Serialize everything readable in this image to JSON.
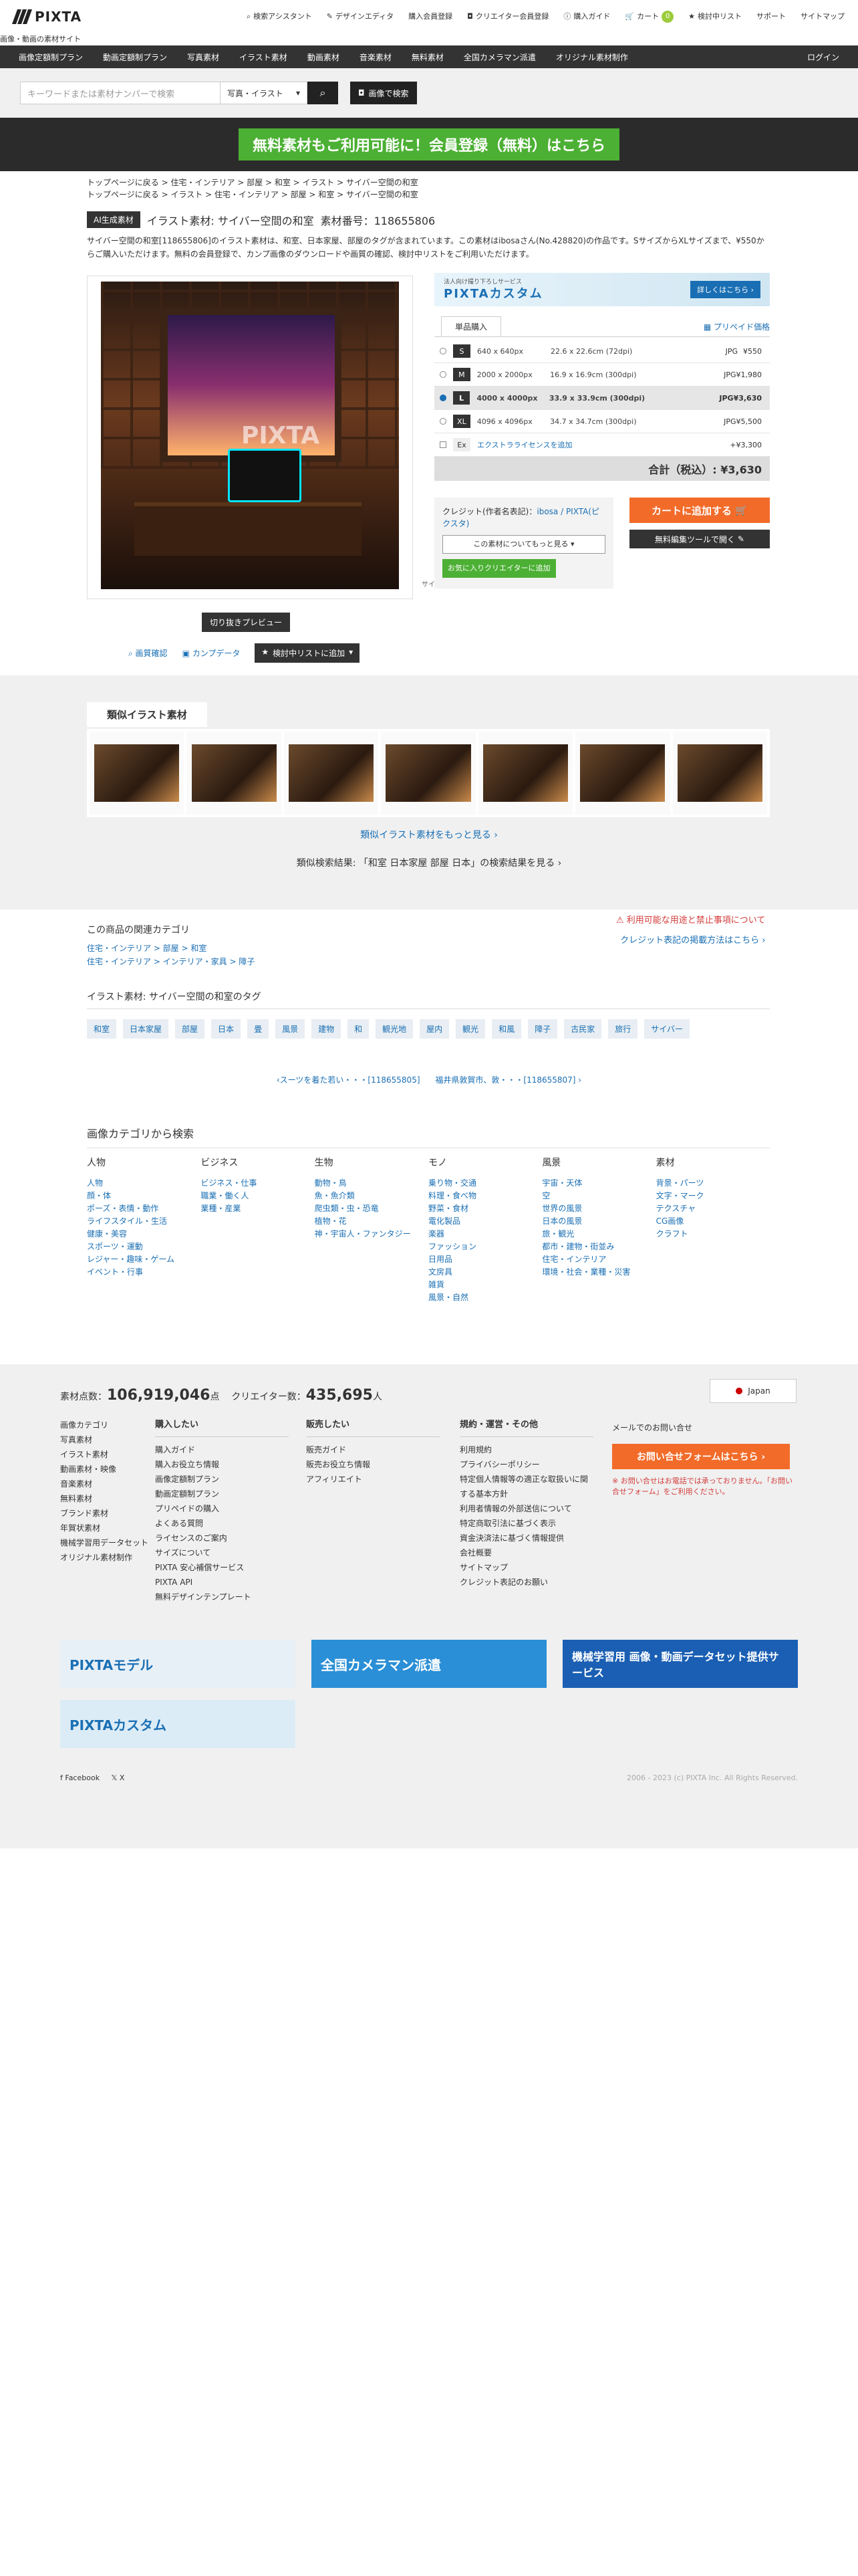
{
  "brand": {
    "name": "PIXTA",
    "tagline": "画像・動画の素材サイト"
  },
  "topnav": [
    {
      "icon": "search-icon",
      "label": "検索アシスタント"
    },
    {
      "icon": "edit-icon",
      "label": "デザインエディタ"
    },
    {
      "icon": "",
      "label": "購入会員登録"
    },
    {
      "icon": "camera-icon",
      "label": "クリエイター会員登録"
    },
    {
      "icon": "info-icon",
      "label": "購入ガイド"
    },
    {
      "icon": "cart-icon",
      "label": "カート",
      "badge": "0"
    },
    {
      "icon": "star-icon",
      "label": "検討中リスト"
    },
    {
      "icon": "",
      "label": "サポート"
    },
    {
      "icon": "",
      "label": "サイトマップ"
    }
  ],
  "mainnav": [
    "画像定額制プラン",
    "動画定額制プラン",
    "写真素材",
    "イラスト素材",
    "動画素材",
    "音楽素材",
    "無料素材",
    "全国カメラマン派遣",
    "オリジナル素材制作"
  ],
  "login": "ログイン",
  "search": {
    "placeholder": "キーワードまたは素材ナンバーで検索",
    "category": "写真・イラスト",
    "image_search": "画像で検索"
  },
  "banner": "無料素材もご利用可能に！会員登録（無料）はこちら",
  "breadcrumbs": [
    "トップページに戻る > 住宅・インテリア > 部屋 > 和室 > イラスト > サイバー空間の和室",
    "トップページに戻る > イラスト > 住宅・インテリア > 部屋 > 和室 > サイバー空間の和室"
  ],
  "item": {
    "ai_tag": "AI生成素材",
    "title": "イラスト素材: サイバー空間の和室",
    "number": "素材番号：118655806",
    "description": "サイバー空間の和室[118655806]のイラスト素材は、和室、日本家屋、部屋のタグが含まれています。この素材はibosaさん(No.428820)の作品です。SサイズからXLサイズまで、¥550からご購入いただけます。無料の会員登録で、カンプ画像のダウンロードや画質の確認、検討中リストをご利用いただけます。",
    "caption": "サイバー空間の和室",
    "watermark": "PIXTA"
  },
  "preview": {
    "crop": "切り抜きプレビュー",
    "quality": "画質確認",
    "comp": "カンプデータ",
    "fav": "検討中リストに追加"
  },
  "promo": {
    "title": "PIXTAカスタム",
    "sub": "法人向け撮り下ろしサービス",
    "cta": "詳しくはこちら ›"
  },
  "purchase": {
    "tab": "単品購入",
    "license": "プリペイド価格",
    "rows": [
      {
        "size": "S",
        "px": "640 x 640px",
        "phys": "22.6 x 22.6cm (72dpi)",
        "fmt": "JPG",
        "price": "¥550"
      },
      {
        "size": "M",
        "px": "2000 x 2000px",
        "phys": "16.9 x 16.9cm (300dpi)",
        "fmt": "JPG",
        "price": "¥1,980"
      },
      {
        "size": "L",
        "px": "4000 x 4000px",
        "phys": "33.9 x 33.9cm (300dpi)",
        "fmt": "JPG",
        "price": "¥3,630"
      },
      {
        "size": "XL",
        "px": "4096 x 4096px",
        "phys": "34.7 x 34.7cm (300dpi)",
        "fmt": "JPG",
        "price": "¥5,500"
      }
    ],
    "extended": {
      "label": "Ex",
      "text": "エクストラライセンスを追加",
      "price": "+¥3,300"
    },
    "total": "合計（税込）: ¥3,630",
    "credit_label": "クレジット(作者名表記)：",
    "credit_value": "ibosa / PIXTA(ピクスタ)",
    "more": "この素材についてもっと見る ▾",
    "fav_creator": "お気に入りクリエイターに追加",
    "cart": "カートに追加する",
    "edit": "無料編集ツールで開く"
  },
  "similar": {
    "title": "類似イラスト素材",
    "more": "類似イラスト素材をもっと見る ›",
    "result": "類似検索結果: 「和室 日本家屋 部屋 日本」の検索結果を見る ›"
  },
  "related": {
    "title": "この商品の関連カテゴリ",
    "links": [
      "住宅・インテリア > 部屋 > 和室",
      "住宅・インテリア > インテリア・家具 > 障子"
    ],
    "warn1": "利用可能な用途と禁止事項について",
    "warn2": "クレジット表記の掲載方法はこちら ›"
  },
  "tags": {
    "title": "イラスト素材: サイバー空間の和室のタグ",
    "items": [
      "和室",
      "日本家屋",
      "部屋",
      "日本",
      "畳",
      "風景",
      "建物",
      "和",
      "観光地",
      "屋内",
      "観光",
      "和風",
      "障子",
      "古民家",
      "旅行",
      "サイバー"
    ]
  },
  "prevnext": {
    "prev": "‹スーツを着た若い・・・[118655805]",
    "next": "福井県敦賀市、敦・・・[118655807] ›"
  },
  "categories": {
    "title": "画像カテゴリから検索",
    "cols": [
      {
        "h": "人物",
        "items": [
          "人物",
          "顔・体",
          "ポーズ・表情・動作",
          "ライフスタイル・生活",
          "健康・美容",
          "スポーツ・運動",
          "レジャー・趣味・ゲーム",
          "イベント・行事"
        ]
      },
      {
        "h": "ビジネス",
        "items": [
          "ビジネス・仕事",
          "職業・働く人",
          "業種・産業"
        ]
      },
      {
        "h": "生物",
        "items": [
          "動物・鳥",
          "魚・魚介類",
          "爬虫類・虫・恐竜",
          "植物・花",
          "神・宇宙人・ファンタジー"
        ]
      },
      {
        "h": "モノ",
        "items": [
          "乗り物・交通",
          "料理・食べ物",
          "野菜・食材",
          "電化製品",
          "楽器",
          "ファッション",
          "日用品",
          "文房具",
          "雑貨",
          "風景・自然"
        ]
      },
      {
        "h": "風景",
        "items": [
          "宇宙・天体",
          "空",
          "世界の風景",
          "日本の風景",
          "旅・観光",
          "都市・建物・街並み",
          "住宅・インテリア",
          "環境・社会・業種・災害"
        ]
      },
      {
        "h": "素材",
        "items": [
          "背景・パーツ",
          "文字・マーク",
          "テクスチャ",
          "CG画像",
          "クラフト"
        ]
      }
    ]
  },
  "footer": {
    "count_label": "素材点数：",
    "count": "106,919,046",
    "count_unit": "点",
    "creators_label": "クリエイター数：",
    "creators": "435,695",
    "creators_unit": "人",
    "lang": "Japan",
    "col1": [
      "画像カテゴリ",
      "写真素材",
      "イラスト素材",
      "動画素材・映像",
      "音楽素材",
      "無料素材",
      "ブランド素材",
      "年賀状素材",
      "機械学習用データセット",
      "オリジナル素材制作"
    ],
    "buy_h": "購入したい",
    "buy": [
      "購入ガイド",
      "購入お役立ち情報",
      "画像定額制プラン",
      "動画定額制プラン",
      "プリペイドの購入",
      "よくある質問",
      "ライセンスのご案内",
      "サイズについて",
      "PIXTA 安心補償サービス",
      "PIXTA API",
      "無料デザインテンプレート"
    ],
    "sell_h": "販売したい",
    "sell": [
      "販売ガイド",
      "販売お役立ち情報",
      "アフィリエイト"
    ],
    "terms_h": "規約・運営・その他",
    "terms": [
      "利用規約",
      "プライバシーポリシー",
      "特定個人情報等の適正な取扱いに関する基本方針",
      "利用者情報の外部送信について",
      "特定商取引法に基づく表示",
      "資金決済法に基づく情報提供",
      "会社概要",
      "サイトマップ",
      "クレジット表記のお願い"
    ],
    "contact_h": "メールでのお問い合せ",
    "contact_btn": "お問い合せフォームはこちら ›",
    "contact_note": "※ お問い合せはお電話では承っておりません。「お問い合せフォーム」をご利用ください。",
    "ads": [
      "PIXTAモデル",
      "全国カメラマン派遣",
      "機械学習用 画像・動画データセット提供サービス",
      "PIXTAカスタム"
    ],
    "social": [
      "Facebook",
      "X"
    ],
    "copyright": "2006 - 2023 (c) PIXTA Inc. All Rights Reserved."
  }
}
